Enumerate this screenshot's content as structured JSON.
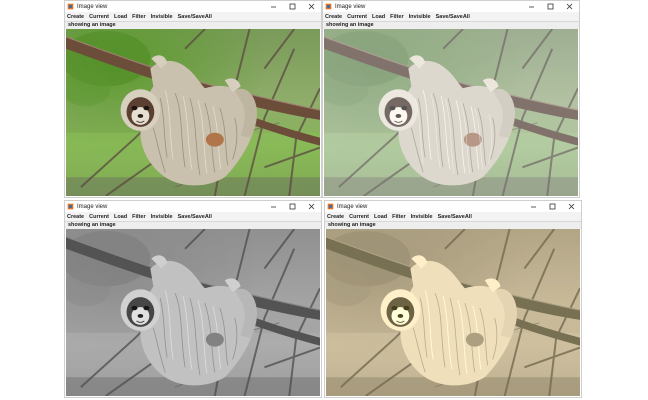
{
  "windows": [
    {
      "title": "Image view",
      "status": "showing an image",
      "filter": "none"
    },
    {
      "title": "Image view",
      "status": "showing an image",
      "filter": "sketch"
    },
    {
      "title": "Image view",
      "status": "showing an image",
      "filter": "grayscale"
    },
    {
      "title": "Image view",
      "status": "showing an image",
      "filter": "sepia"
    }
  ],
  "menu": [
    "Create",
    "Current",
    "Load",
    "Filter",
    "Invisible",
    "Save/SaveAll"
  ],
  "colors": {
    "foliage": "#6fa342",
    "grass": "#8fbf5a",
    "branch": "#6b4d3a",
    "fur": "#c9c0ad",
    "face": "#5b4032"
  }
}
